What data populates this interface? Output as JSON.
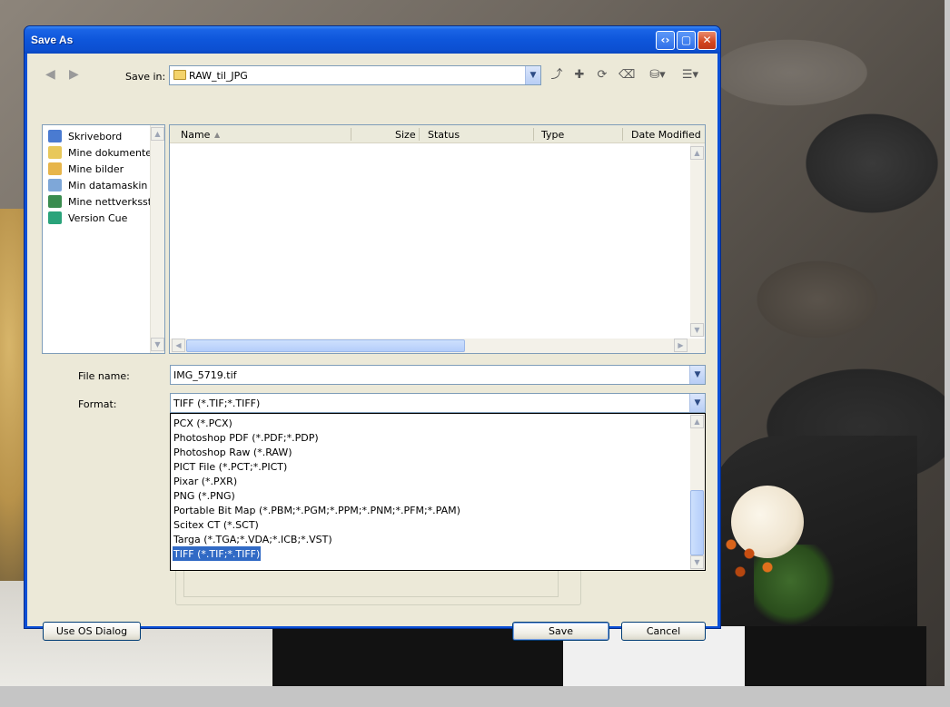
{
  "dialog": {
    "title": "Save As"
  },
  "toolbar": {
    "save_in_label": "Save in:",
    "save_in_value": "RAW_til_JPG"
  },
  "places": [
    {
      "label": "Skrivebord",
      "icon": "desktop-icon",
      "color": "#4a7bd1"
    },
    {
      "label": "Mine dokumenter",
      "icon": "my-documents-icon",
      "color": "#e8c85a"
    },
    {
      "label": "Mine bilder",
      "icon": "my-pictures-icon",
      "color": "#e7b54a"
    },
    {
      "label": "Min datamaskin",
      "icon": "my-computer-icon",
      "color": "#7ea7d8"
    },
    {
      "label": "Mine nettverkssteder",
      "icon": "network-places-icon",
      "color": "#3a8c4f"
    },
    {
      "label": "Version Cue",
      "icon": "version-cue-icon",
      "color": "#2aa37a"
    }
  ],
  "filelist": {
    "columns": [
      "Name",
      "Size",
      "Status",
      "Type",
      "Date Modified"
    ],
    "sort_indicator": "▲"
  },
  "filename": {
    "label": "File name:",
    "value": "IMG_5719.tif"
  },
  "format": {
    "label": "Format:",
    "value": "TIFF (*.TIF;*.TIFF)",
    "options": [
      "PCX (*.PCX)",
      "Photoshop PDF (*.PDF;*.PDP)",
      "Photoshop Raw (*.RAW)",
      "PICT File (*.PCT;*.PICT)",
      "Pixar (*.PXR)",
      "PNG (*.PNG)",
      "Portable Bit Map (*.PBM;*.PGM;*.PPM;*.PNM;*.PFM;*.PAM)",
      "Scitex CT (*.SCT)",
      "Targa (*.TGA;*.VDA;*.ICB;*.VST)",
      "TIFF (*.TIF;*.TIFF)"
    ],
    "selected_index": 9
  },
  "buttons": {
    "use_os_dialog": "Use OS Dialog",
    "save": "Save",
    "cancel": "Cancel"
  },
  "colors": {
    "titlebar": "#0c4fd0",
    "selection": "#316ac5",
    "dialog_bg": "#ece9d8"
  }
}
